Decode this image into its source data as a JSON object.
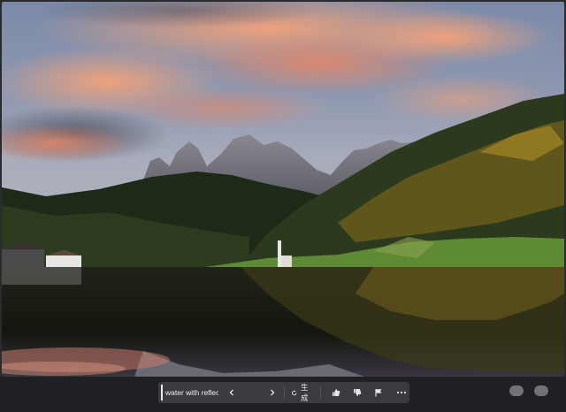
{
  "image": {
    "alt": "mountain lake landscape"
  },
  "toolbar": {
    "search_value": "water with reflectio",
    "prev_icon": "chevron-left-icon",
    "next_icon": "chevron-right-icon",
    "generate_icon": "refresh-icon",
    "generate_label": "生成",
    "like_icon": "thumbs-up-icon",
    "dislike_icon": "thumbs-down-icon",
    "flag_icon": "flag-icon",
    "more_icon": "more-horizontal-icon"
  },
  "colors": {
    "toolbar_bg": "#3a3b3f",
    "bar_bg": "#1f2023",
    "text": "#e9e9ea"
  }
}
